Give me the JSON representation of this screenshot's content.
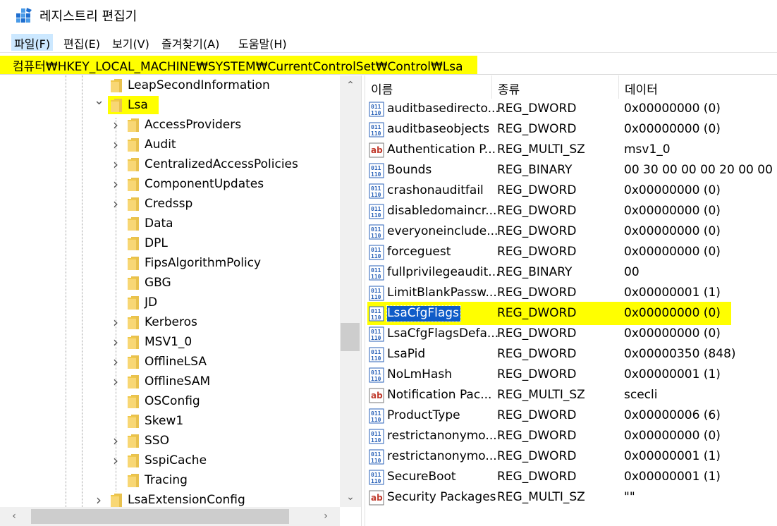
{
  "window": {
    "title": "레지스트리 편집기"
  },
  "menu": [
    {
      "label": "파일(F)"
    },
    {
      "label": "편집(E)"
    },
    {
      "label": "보기(V)"
    },
    {
      "label": "즐겨찾기(A)"
    },
    {
      "label": "도움말(H)"
    }
  ],
  "address": {
    "path": "컴퓨터₩HKEY_LOCAL_MACHINE₩SYSTEM₩CurrentControlSet₩Control₩Lsa"
  },
  "tree": {
    "items": [
      {
        "label": "LeapSecondInformation",
        "level": 2,
        "chevron": "none"
      },
      {
        "label": "Lsa",
        "level": 2,
        "chevron": "expanded",
        "highlighted": true
      },
      {
        "label": "AccessProviders",
        "level": 3,
        "chevron": "collapsed"
      },
      {
        "label": "Audit",
        "level": 3,
        "chevron": "collapsed"
      },
      {
        "label": "CentralizedAccessPolicies",
        "level": 3,
        "chevron": "collapsed"
      },
      {
        "label": "ComponentUpdates",
        "level": 3,
        "chevron": "collapsed"
      },
      {
        "label": "Credssp",
        "level": 3,
        "chevron": "collapsed"
      },
      {
        "label": "Data",
        "level": 3,
        "chevron": "none"
      },
      {
        "label": "DPL",
        "level": 3,
        "chevron": "none"
      },
      {
        "label": "FipsAlgorithmPolicy",
        "level": 3,
        "chevron": "none"
      },
      {
        "label": "GBG",
        "level": 3,
        "chevron": "none"
      },
      {
        "label": "JD",
        "level": 3,
        "chevron": "none"
      },
      {
        "label": "Kerberos",
        "level": 3,
        "chevron": "collapsed"
      },
      {
        "label": "MSV1_0",
        "level": 3,
        "chevron": "collapsed"
      },
      {
        "label": "OfflineLSA",
        "level": 3,
        "chevron": "collapsed"
      },
      {
        "label": "OfflineSAM",
        "level": 3,
        "chevron": "collapsed"
      },
      {
        "label": "OSConfig",
        "level": 3,
        "chevron": "none"
      },
      {
        "label": "Skew1",
        "level": 3,
        "chevron": "none"
      },
      {
        "label": "SSO",
        "level": 3,
        "chevron": "collapsed"
      },
      {
        "label": "SspiCache",
        "level": 3,
        "chevron": "collapsed"
      },
      {
        "label": "Tracing",
        "level": 3,
        "chevron": "none"
      },
      {
        "label": "LsaExtensionConfig",
        "level": 2,
        "chevron": "collapsed"
      }
    ]
  },
  "list": {
    "columns": [
      "이름",
      "종류",
      "데이터"
    ],
    "rows": [
      {
        "icon": "binary-value-icon",
        "name": "auditbasedirecto...",
        "type": "REG_DWORD",
        "data": "0x00000000 (0)"
      },
      {
        "icon": "binary-value-icon",
        "name": "auditbaseobjects",
        "type": "REG_DWORD",
        "data": "0x00000000 (0)"
      },
      {
        "icon": "string-value-icon",
        "name": "Authentication P...",
        "type": "REG_MULTI_SZ",
        "data": "msv1_0"
      },
      {
        "icon": "binary-value-icon",
        "name": "Bounds",
        "type": "REG_BINARY",
        "data": "00 30 00 00 00 20 00 00"
      },
      {
        "icon": "binary-value-icon",
        "name": "crashonauditfail",
        "type": "REG_DWORD",
        "data": "0x00000000 (0)"
      },
      {
        "icon": "binary-value-icon",
        "name": "disabledomaincr...",
        "type": "REG_DWORD",
        "data": "0x00000000 (0)"
      },
      {
        "icon": "binary-value-icon",
        "name": "everyoneinclude...",
        "type": "REG_DWORD",
        "data": "0x00000000 (0)"
      },
      {
        "icon": "binary-value-icon",
        "name": "forceguest",
        "type": "REG_DWORD",
        "data": "0x00000000 (0)"
      },
      {
        "icon": "binary-value-icon",
        "name": "fullprivilegeaudit...",
        "type": "REG_BINARY",
        "data": "00"
      },
      {
        "icon": "binary-value-icon",
        "name": "LimitBlankPassw...",
        "type": "REG_DWORD",
        "data": "0x00000001 (1)"
      },
      {
        "icon": "binary-value-icon",
        "name": "LsaCfgFlags",
        "type": "REG_DWORD",
        "data": "0x00000000 (0)",
        "selected": true
      },
      {
        "icon": "binary-value-icon",
        "name": "LsaCfgFlagsDefa...",
        "type": "REG_DWORD",
        "data": "0x00000000 (0)"
      },
      {
        "icon": "binary-value-icon",
        "name": "LsaPid",
        "type": "REG_DWORD",
        "data": "0x00000350 (848)"
      },
      {
        "icon": "binary-value-icon",
        "name": "NoLmHash",
        "type": "REG_DWORD",
        "data": "0x00000001 (1)"
      },
      {
        "icon": "string-value-icon",
        "name": "Notification Pac...",
        "type": "REG_MULTI_SZ",
        "data": "scecli"
      },
      {
        "icon": "binary-value-icon",
        "name": "ProductType",
        "type": "REG_DWORD",
        "data": "0x00000006 (6)"
      },
      {
        "icon": "binary-value-icon",
        "name": "restrictanonymo...",
        "type": "REG_DWORD",
        "data": "0x00000000 (0)"
      },
      {
        "icon": "binary-value-icon",
        "name": "restrictanonymo...",
        "type": "REG_DWORD",
        "data": "0x00000001 (1)"
      },
      {
        "icon": "binary-value-icon",
        "name": "SecureBoot",
        "type": "REG_DWORD",
        "data": "0x00000001 (1)"
      },
      {
        "icon": "string-value-icon",
        "name": "Security Packages",
        "type": "REG_MULTI_SZ",
        "data": "\"\""
      }
    ]
  },
  "colors": {
    "highlight": "#ffff00",
    "selection": "#0f5cc8",
    "folder": "#f8d775"
  }
}
